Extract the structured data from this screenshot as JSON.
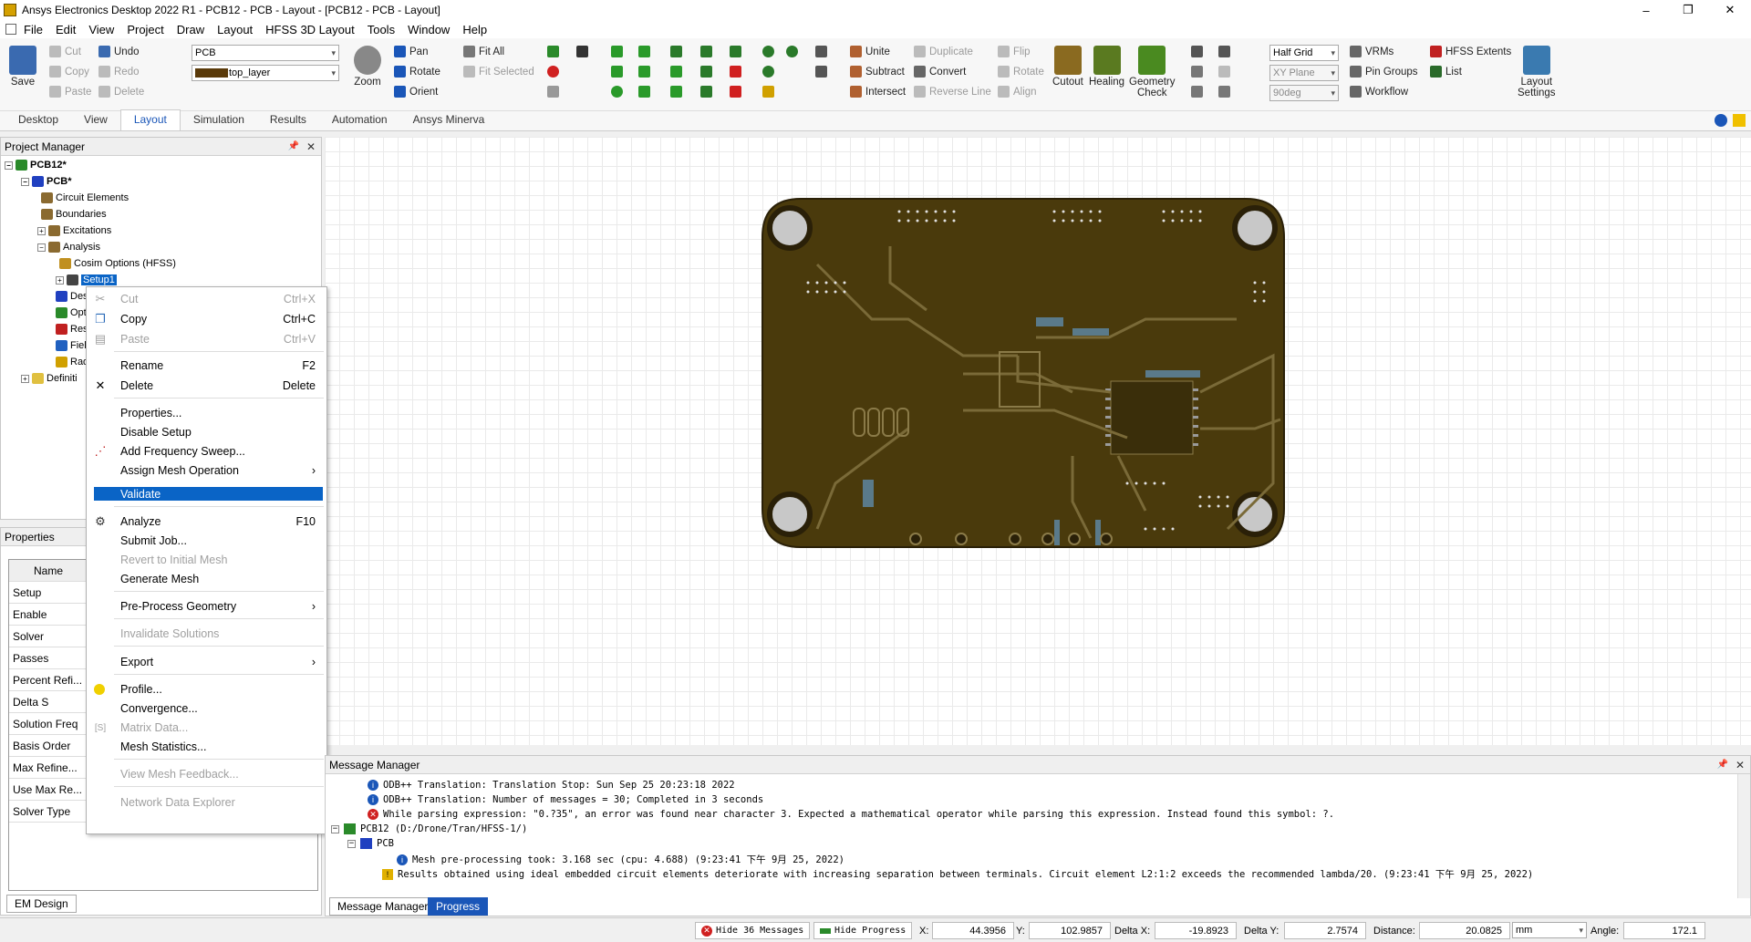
{
  "window": {
    "title": "Ansys Electronics Desktop 2022 R1 - PCB12 - PCB - Layout - [PCB12 - PCB - Layout]",
    "minimize": "–",
    "maximize": "❐",
    "close": "✕"
  },
  "menu": [
    "File",
    "Edit",
    "View",
    "Project",
    "Draw",
    "Layout",
    "HFSS 3D Layout",
    "Tools",
    "Window",
    "Help"
  ],
  "ribbon": {
    "save": "Save",
    "cut": "Cut",
    "copy": "Copy",
    "paste": "Paste",
    "undo": "Undo",
    "redo": "Redo",
    "delete": "Delete",
    "design_combo": "PCB",
    "layer_combo": "top_layer",
    "zoom": "Zoom",
    "pan": "Pan",
    "rotate": "Rotate",
    "orient": "Orient",
    "fit_all": "Fit All",
    "fit_selected": "Fit Selected",
    "unite": "Unite",
    "subtract": "Subtract",
    "intersect": "Intersect",
    "duplicate": "Duplicate",
    "convert": "Convert",
    "reverse_line": "Reverse Line",
    "flip": "Flip",
    "rotate2": "Rotate",
    "align": "Align",
    "cutout": "Cutout",
    "healing": "Healing",
    "geometry_check": "Geometry\nCheck",
    "grid_combo": "Half Grid",
    "plane_combo": "XY Plane",
    "angle_combo": "90deg",
    "vrms": "VRMs",
    "pin_groups": "Pin Groups",
    "workflow": "Workflow",
    "hfss_extents": "HFSS Extents",
    "list": "List",
    "layout_settings": "Layout\nSettings"
  },
  "tabs": [
    "Desktop",
    "View",
    "Layout",
    "Simulation",
    "Results",
    "Automation",
    "Ansys Minerva"
  ],
  "active_tab": "Layout",
  "project_manager": {
    "title": "Project Manager",
    "tree": {
      "project": "PCB12*",
      "design": "PCB*",
      "circuit_elements": "Circuit Elements",
      "boundaries": "Boundaries",
      "excitations": "Excitations",
      "analysis": "Analysis",
      "cosim": "Cosim Options (HFSS)",
      "setup": "Setup1",
      "des": "Des",
      "opt": "Opt",
      "res": "Res",
      "fiel": "Fiel",
      "rad": "Rad",
      "defs": "Definiti"
    }
  },
  "properties": {
    "title": "Properties",
    "header": "Name",
    "rows": [
      "Setup",
      "Enable",
      "Solver",
      "Passes",
      "Percent Refi...",
      "Delta S",
      "Solution Freq",
      "Basis Order",
      "Max Refine...",
      "Use Max Re...",
      "Solver Type"
    ],
    "bottom_tab": "EM Design"
  },
  "context_menu": {
    "cut": {
      "label": "Cut",
      "shortcut": "Ctrl+X"
    },
    "copy": {
      "label": "Copy",
      "shortcut": "Ctrl+C"
    },
    "paste": {
      "label": "Paste",
      "shortcut": "Ctrl+V"
    },
    "rename": {
      "label": "Rename",
      "shortcut": "F2"
    },
    "delete": {
      "label": "Delete",
      "shortcut": "Delete"
    },
    "properties": "Properties...",
    "disable_setup": "Disable Setup",
    "add_freq_sweep": "Add Frequency Sweep...",
    "assign_mesh": "Assign Mesh Operation",
    "validate": "Validate",
    "analyze": {
      "label": "Analyze",
      "shortcut": "F10"
    },
    "submit_job": "Submit Job...",
    "revert_mesh": "Revert to Initial Mesh",
    "generate_mesh": "Generate Mesh",
    "preprocess": "Pre-Process Geometry",
    "invalidate": "Invalidate Solutions",
    "export": "Export",
    "profile": "Profile...",
    "convergence": "Convergence...",
    "matrix_data": "Matrix Data...",
    "mesh_stats": "Mesh Statistics...",
    "view_mesh_feedback": "View Mesh Feedback...",
    "network_data": "Network Data Explorer",
    "submenu_arrow": "›"
  },
  "message_manager": {
    "title": "Message Manager",
    "lines": [
      "ODB++ Translation: Translation Stop: Sun Sep 25 20:23:18 2022",
      "ODB++ Translation: Number of messages = 30; Completed in 3 seconds",
      "While parsing expression: \"0.?35\", an error was found near character 3. Expected a mathematical operator while parsing this expression. Instead found this symbol: ?.",
      "PCB12 (D:/Drone/Tran/HFSS-1/)",
      "PCB",
      "Mesh pre-processing took: 3.168 sec (cpu: 4.688) (9:23:41 下午  9月 25, 2022)",
      "Results obtained using ideal embedded circuit elements deteriorate with increasing separation between terminals.  Circuit element L2:1:2 exceeds the recommended lambda/20. (9:23:41 下午  9月 25, 2022)"
    ],
    "tab_msg": "Message Manager",
    "tab_progress": "Progress"
  },
  "status": {
    "hide_messages": "Hide 36 Messages",
    "hide_progress": "Hide Progress",
    "x_label": "X:",
    "x": "44.3956",
    "y_label": "Y:",
    "y": "102.9857",
    "dx_label": "Delta X:",
    "dx": "-19.8923",
    "dy_label": "Delta Y:",
    "dy": "2.7574",
    "dist_label": "Distance:",
    "dist": "20.0825",
    "unit": "mm",
    "angle_label": "Angle:",
    "angle": "172.1"
  },
  "colors": {
    "board": "#4a3a0c",
    "trace": "#5a4a10",
    "copper_edge": "#7a6a38",
    "pad": "#c8c8c8",
    "highlight": "#0a64c6"
  }
}
